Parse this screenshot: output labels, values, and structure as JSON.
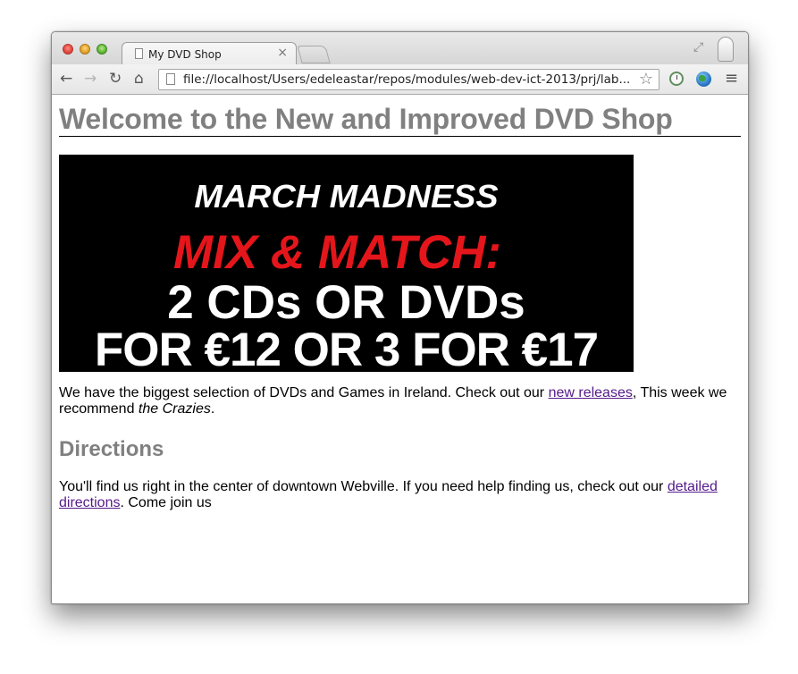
{
  "browser": {
    "tab_title": "My DVD Shop",
    "tab_close": "×",
    "url": "file://localhost/Users/edeleastar/repos/modules/web-dev-ict-2013/prj/lab...",
    "icons": {
      "back": "←",
      "forward": "→",
      "reload": "↻",
      "home": "⌂",
      "star": "☆",
      "fullscreen": "⤢",
      "menu": "≡"
    }
  },
  "page": {
    "title": "Welcome to the New and Improved DVD Shop",
    "banner": {
      "line1": "MARCH MADNESS",
      "line2": "MIX & MATCH:",
      "line3": "2 CDs OR DVDs",
      "line4": "FOR €12 OR 3 FOR €17"
    },
    "intro": {
      "text1": "We have the biggest selection of DVDs and Games in Ireland. Check out our ",
      "link": "new releases",
      "text2": ", This week we recommend ",
      "em": "the Crazies",
      "text3": "."
    },
    "directions": {
      "heading": "Directions",
      "text1": "You'll find us right in the center of downtown Webville. If you need help finding us, check out our ",
      "link": "detailed directions",
      "text2": ". Come join us"
    }
  },
  "colors": {
    "heading_gray": "#808080",
    "banner_red": "#e4161b",
    "visited_link": "#551a8b"
  }
}
